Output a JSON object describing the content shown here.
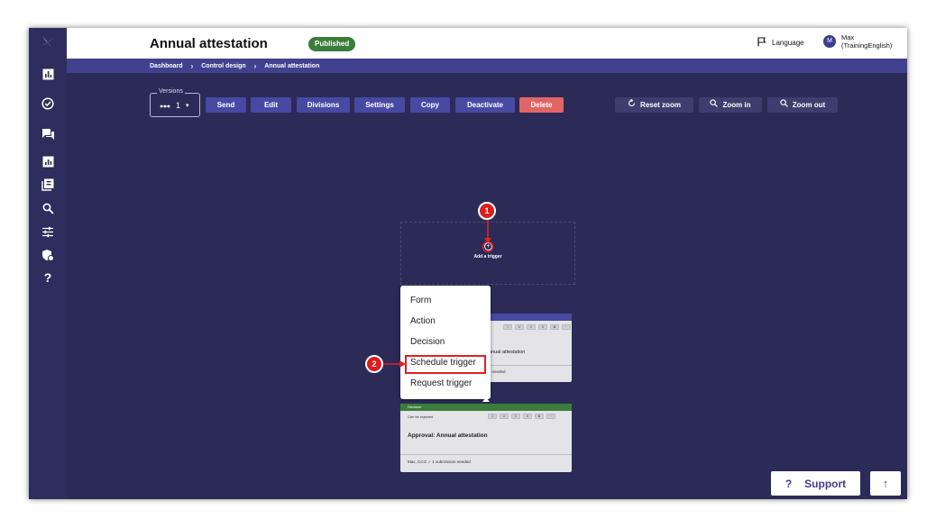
{
  "header": {
    "title": "Annual attestation",
    "status": "Published",
    "language_label": "Language",
    "user_initial": "M",
    "user_name": "Max",
    "user_org": "(TrainingEnglish)"
  },
  "breadcrumb": [
    "Dashboard",
    "Control design",
    "Annual attestation"
  ],
  "toolbar": {
    "versions_label": "Versions",
    "versions_value": "1",
    "buttons": [
      "Send",
      "Edit",
      "Divisions",
      "Settings",
      "Copy",
      "Deactivate",
      "Delete"
    ],
    "zoom": [
      "Reset zoom",
      "Zoom in",
      "Zoom out"
    ]
  },
  "canvas": {
    "add_trigger_label": "Add a trigger",
    "menu_items": [
      "Form",
      "Action",
      "Decision",
      "Schedule trigger",
      "Request trigger"
    ],
    "card1": {
      "title_fragment": "nnual attestation",
      "footer_fragment": "s needed"
    },
    "card2": {
      "type_label": "Decision",
      "subtitle": "Can be rejected",
      "title": "Approval: Annual attestation",
      "footer": "Max, CCO  ✓ 1 submission needed"
    }
  },
  "callouts": [
    "1",
    "2"
  ],
  "support_label": "Support",
  "colors": {
    "canvas_bg": "#2c2b58",
    "primary_button": "#4849a3",
    "delete_button": "#e06666",
    "published_badge": "#3b7d3b",
    "callout": "#dd1c1c"
  },
  "icons": [
    "logo-icon",
    "bar-chart-icon",
    "check-circle-icon",
    "chat-icon",
    "report-icon",
    "library-icon",
    "search-icon",
    "sliders-icon",
    "shield-icon",
    "help-icon",
    "flag-icon",
    "refresh-icon",
    "zoom-in-icon",
    "zoom-out-icon",
    "add-circle-icon",
    "arrow-up-icon"
  ]
}
